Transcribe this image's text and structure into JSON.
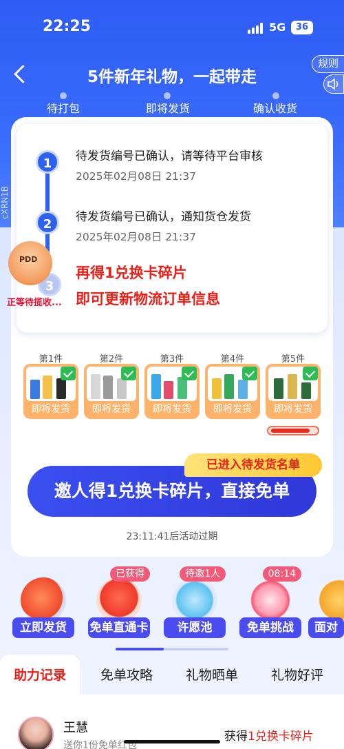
{
  "status_bar": {
    "time": "22:25",
    "network": "5G",
    "battery": "36"
  },
  "nav": {
    "title": "5件新年礼物，一起带走",
    "rules_label": "规则"
  },
  "progress_steps": [
    "待打包",
    "即将发货",
    "确认收货"
  ],
  "side_code": "cXRN1B",
  "tracking": {
    "items": [
      {
        "num": "1",
        "text": "待发货编号已确认，请等待平台审核",
        "time": "2025年02月08日 21:37"
      },
      {
        "num": "2",
        "text": "待发货编号已确认，通知货仓发货",
        "time": "2025年02月08日 21:37"
      }
    ],
    "step3_num": "3",
    "red_tip_line1": "再得1兑换卡碎片",
    "red_tip_line2": "即可更新物流订单信息",
    "courier_label": "正等待揽收..."
  },
  "gifts": [
    {
      "title": "第1件",
      "label": "即将发货"
    },
    {
      "title": "第2件",
      "label": "即将发货"
    },
    {
      "title": "第3件",
      "label": "即将发货"
    },
    {
      "title": "第4件",
      "label": "即将发货"
    },
    {
      "title": "第5件",
      "label": "即将发货"
    }
  ],
  "cta": {
    "badge": "已进入待发货名单",
    "label": "邀人得1兑换卡碎片，直接免单"
  },
  "countdown": "23:11:41后活动过期",
  "features": [
    {
      "label": "立即发货",
      "badge": ""
    },
    {
      "label": "免单直通卡",
      "badge": "已获得"
    },
    {
      "label": "许愿池",
      "badge": "待邀1人"
    },
    {
      "label": "免单挑战",
      "badge": "08:14"
    },
    {
      "label": "面对",
      "badge": ""
    }
  ],
  "tabs": [
    "助力记录",
    "免单攻略",
    "礼物晒单",
    "礼物好评"
  ],
  "record": {
    "name": "王慧",
    "sub": "送你1份免单红包",
    "reward_prefix": "获得",
    "reward_highlight": "1兑换卡碎片"
  },
  "colors": {
    "primary_blue": "#2e5cf5",
    "accent_red": "#e8221b",
    "gift_orange": "#ffb36a"
  }
}
